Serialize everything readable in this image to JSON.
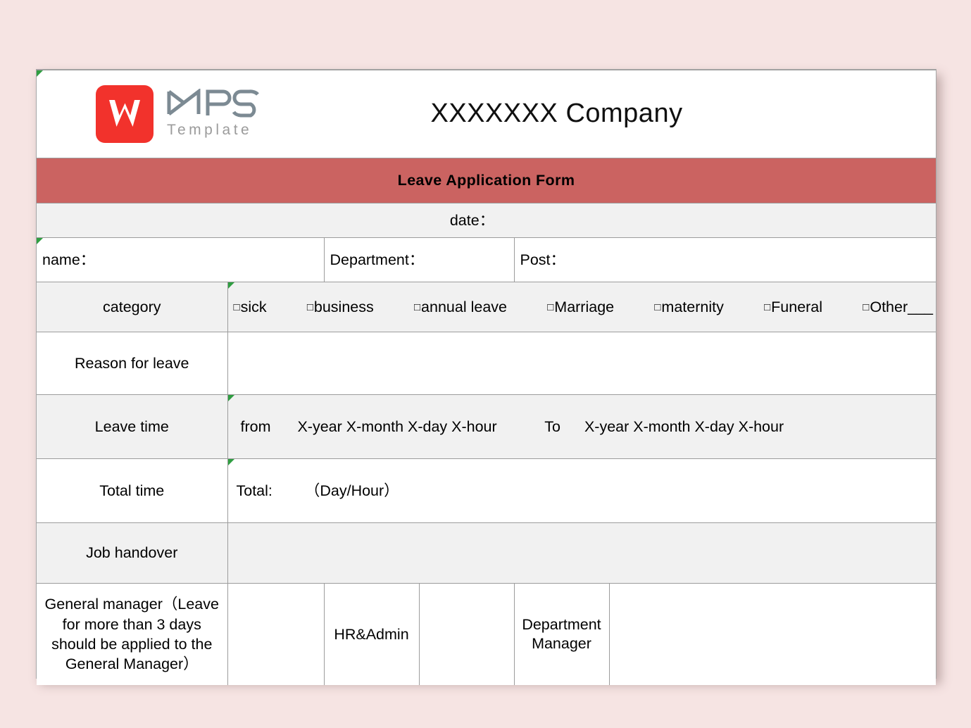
{
  "theme": {
    "page_background": "#f6e4e3",
    "sheet_background": "#ffffff",
    "title_bar_color": "#cb6361",
    "alt_row_color": "#f1f1f1",
    "grid_line_color": "#9c9c9c",
    "logo_red": "#f2322c",
    "comment_marker_color": "#2f9e41"
  },
  "header": {
    "logo_brand": "WPS",
    "logo_subtitle": "Template",
    "company_title": "XXXXXXX  Company"
  },
  "title_bar": {
    "text": "Leave Application Form"
  },
  "rows": {
    "date": {
      "label": "date："
    },
    "identity": {
      "name_label": "name：",
      "department_label": "Department：",
      "post_label": "Post："
    },
    "category": {
      "label": "category",
      "checkbox_glyph": "□",
      "options": [
        "sick",
        "business",
        "annual leave",
        "Marriage",
        "maternity",
        "Funeral",
        "Other___"
      ]
    },
    "reason": {
      "label": "Reason for leave",
      "value": ""
    },
    "leave_time": {
      "label": "Leave time",
      "from_label": "from",
      "from_value": "X-year X-month X-day X-hour",
      "to_label": "To",
      "to_value": "X-year X-month X-day X-hour"
    },
    "total_time": {
      "label": "Total time",
      "total_label": "Total:",
      "unit_note": "（Day/Hour）"
    },
    "job_handover": {
      "label": "Job handover",
      "value": ""
    },
    "approval": {
      "general_manager_label": "General manager（Leave for more than 3 days should be applied to the General Manager）",
      "general_manager_signature": "",
      "hr_admin_label": "HR&Admin",
      "hr_admin_signature": "",
      "department_manager_label": "Department Manager",
      "department_manager_signature": ""
    }
  }
}
